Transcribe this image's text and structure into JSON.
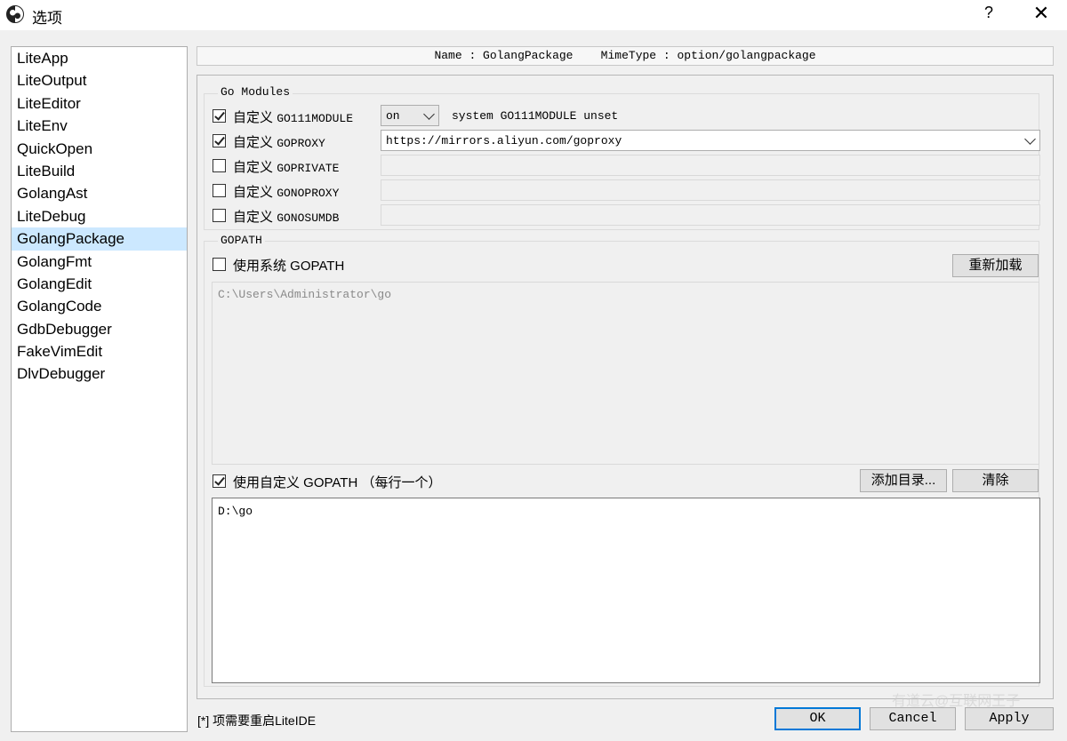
{
  "window": {
    "title": "选项",
    "help_label": "?",
    "close_label": "✕"
  },
  "nav": {
    "items": [
      {
        "label": "LiteApp"
      },
      {
        "label": "LiteOutput"
      },
      {
        "label": "LiteEditor"
      },
      {
        "label": "LiteEnv"
      },
      {
        "label": "QuickOpen"
      },
      {
        "label": "LiteBuild"
      },
      {
        "label": "GolangAst"
      },
      {
        "label": "LiteDebug"
      },
      {
        "label": "GolangPackage",
        "selected": true
      },
      {
        "label": "GolangFmt"
      },
      {
        "label": "GolangEdit"
      },
      {
        "label": "GolangCode"
      },
      {
        "label": "GdbDebugger"
      },
      {
        "label": "FakeVimEdit"
      },
      {
        "label": "DlvDebugger"
      }
    ]
  },
  "header": {
    "text": "Name : GolangPackage    MimeType : option/golangpackage"
  },
  "go_modules": {
    "title": "Go Modules",
    "rows": [
      {
        "prefix": "自定义",
        "name": "GO111MODULE",
        "checked": true
      },
      {
        "prefix": "自定义",
        "name": "GOPROXY",
        "checked": true
      },
      {
        "prefix": "自定义",
        "name": "GOPRIVATE",
        "checked": false
      },
      {
        "prefix": "自定义",
        "name": "GONOPROXY",
        "checked": false
      },
      {
        "prefix": "自定义",
        "name": "GONOSUMDB",
        "checked": false
      }
    ],
    "module_select_value": "on",
    "module_status": "system GO111MODULE unset",
    "proxy_value": "https://mirrors.aliyun.com/goproxy"
  },
  "gopath": {
    "title": "GOPATH",
    "use_system_label": "使用系统 GOPATH",
    "use_system_checked": false,
    "reload_label": "重新加载",
    "system_path": "C:\\Users\\Administrator\\go",
    "use_custom_label": "使用自定义 GOPATH （每行一个）",
    "use_custom_checked": true,
    "add_dir_label": "添加目录...",
    "clear_label": "清除",
    "custom_path": "D:\\go"
  },
  "footer": {
    "note": "[*] 项需要重启LiteIDE",
    "ok_label": "OK",
    "cancel_label": "Cancel",
    "apply_label": "Apply"
  },
  "watermark": "有道云@互联网王子"
}
